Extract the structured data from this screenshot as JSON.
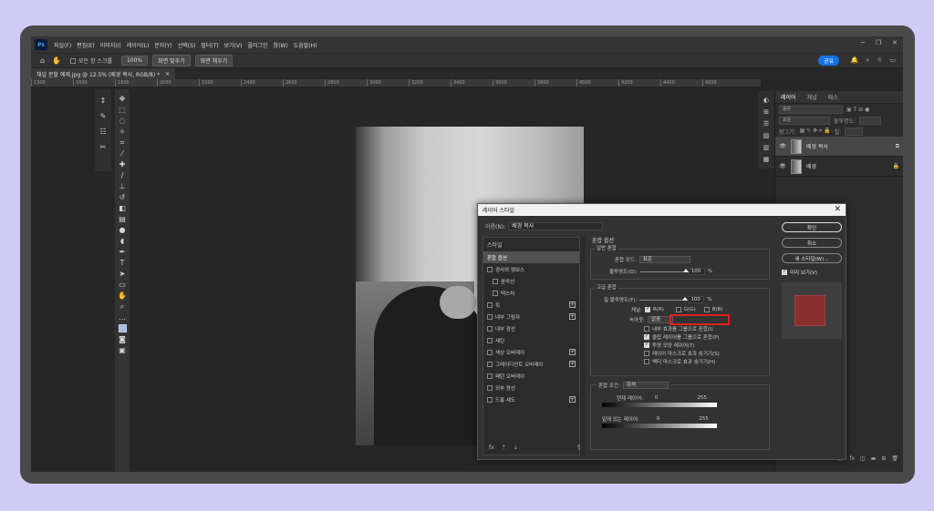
{
  "menu": {
    "logo": "Ps",
    "items": [
      "파일(F)",
      "편집(E)",
      "이미지(I)",
      "레이어(L)",
      "문자(Y)",
      "선택(S)",
      "필터(T)",
      "보기(V)",
      "플러그인",
      "창(W)",
      "도움말(H)"
    ]
  },
  "options": {
    "scroll_all": "모든 창 스크롤",
    "zoom": "100%",
    "fit_screen": "화면 맞추기",
    "fill_screen": "화면 채우기",
    "share": "공유"
  },
  "document": {
    "tab_title": "채널 분할 예제.jpg @ 12.5% (배경 복사, RGB/8) *",
    "ruler_ticks": [
      "1300",
      "1600",
      "1800",
      "2000",
      "2200",
      "2400",
      "2600",
      "2800",
      "3000",
      "3200",
      "3400",
      "3600",
      "3800",
      "4000",
      "4200",
      "4400",
      "4600"
    ]
  },
  "layers_panel": {
    "tabs": [
      "레이어",
      "채널",
      "패스"
    ],
    "filter_label": "종류",
    "blend_mode": "표준",
    "opacity_label": "불투명도:",
    "lock_label": "잠그기:",
    "fill_label": "칠:",
    "layers": [
      {
        "name": "배경 복사",
        "selected": true
      },
      {
        "name": "배경",
        "selected": false
      }
    ]
  },
  "dialog": {
    "title": "레이어 스타일",
    "name_label": "이름(N):",
    "name_value": "배경 복사",
    "style_header": "스타일",
    "styles": [
      {
        "label": "혼합 옵션",
        "active": true,
        "checkbox": false,
        "plus": false,
        "indent": false
      },
      {
        "label": "경사와 엠보스",
        "active": false,
        "checkbox": true,
        "plus": false,
        "indent": false
      },
      {
        "label": "윤곽선",
        "active": false,
        "checkbox": true,
        "plus": false,
        "indent": true
      },
      {
        "label": "텍스처",
        "active": false,
        "checkbox": true,
        "plus": false,
        "indent": true
      },
      {
        "label": "획",
        "active": false,
        "checkbox": true,
        "plus": true,
        "indent": false
      },
      {
        "label": "내부 그림자",
        "active": false,
        "checkbox": true,
        "plus": true,
        "indent": false
      },
      {
        "label": "내부 광선",
        "active": false,
        "checkbox": true,
        "plus": false,
        "indent": false
      },
      {
        "label": "새틴",
        "active": false,
        "checkbox": true,
        "plus": false,
        "indent": false
      },
      {
        "label": "색상 오버레이",
        "active": false,
        "checkbox": true,
        "plus": true,
        "indent": false
      },
      {
        "label": "그레이디언트 오버레이",
        "active": false,
        "checkbox": true,
        "plus": true,
        "indent": false
      },
      {
        "label": "패턴 오버레이",
        "active": false,
        "checkbox": true,
        "plus": false,
        "indent": false
      },
      {
        "label": "외부 광선",
        "active": false,
        "checkbox": true,
        "plus": false,
        "indent": false
      },
      {
        "label": "드롭 섀도",
        "active": false,
        "checkbox": true,
        "plus": true,
        "indent": false
      }
    ],
    "footer_fx": "fx",
    "blend_options_title": "혼합 옵션",
    "general_blending": "일반 혼합",
    "blend_mode_label": "혼합 모드:",
    "blend_mode_value": "표준",
    "opacity_label": "불투명도(O):",
    "opacity_value": "100",
    "opacity_fraction": 1.0,
    "percent": "%",
    "advanced_blending": "고급 혼합",
    "fill_opacity_label": "칠 불투명도(F):",
    "fill_opacity_value": "100",
    "fill_opacity_fraction": 1.0,
    "channels_label": "채널:",
    "channel_r": "R(R)",
    "channel_g": "G(G)",
    "channel_b": "B(B)",
    "channel_r_checked": true,
    "channel_g_checked": false,
    "channel_b_checked": false,
    "knockout_label": "녹아웃:",
    "knockout_value": "없음",
    "adv_options": [
      {
        "label": "내부 효과를 그룹으로 혼합(I)",
        "checked": false
      },
      {
        "label": "클립 레이어를 그룹으로 혼합(P)",
        "checked": true
      },
      {
        "label": "투명 모양 레이어(T)",
        "checked": true
      },
      {
        "label": "레이어 마스크로 효과 숨기기(S)",
        "checked": false
      },
      {
        "label": "벡터 마스크로 효과 숨기기(H)",
        "checked": false
      }
    ],
    "blend_if_label": "혼합 조건:",
    "blend_if_value": "회색",
    "this_layer_label": "현재 레이어:",
    "underlying_label": "밑에 있는 레이어:",
    "range_min": "0",
    "range_max": "255",
    "ok": "확인",
    "cancel": "취소",
    "new_style": "새 스타일(W)...",
    "preview_label": "미리 보기(V)",
    "preview_checked": true,
    "preview_color": "#8b2f2f"
  },
  "colors": {
    "highlight": "#e02020",
    "accent": "#1473e6"
  }
}
